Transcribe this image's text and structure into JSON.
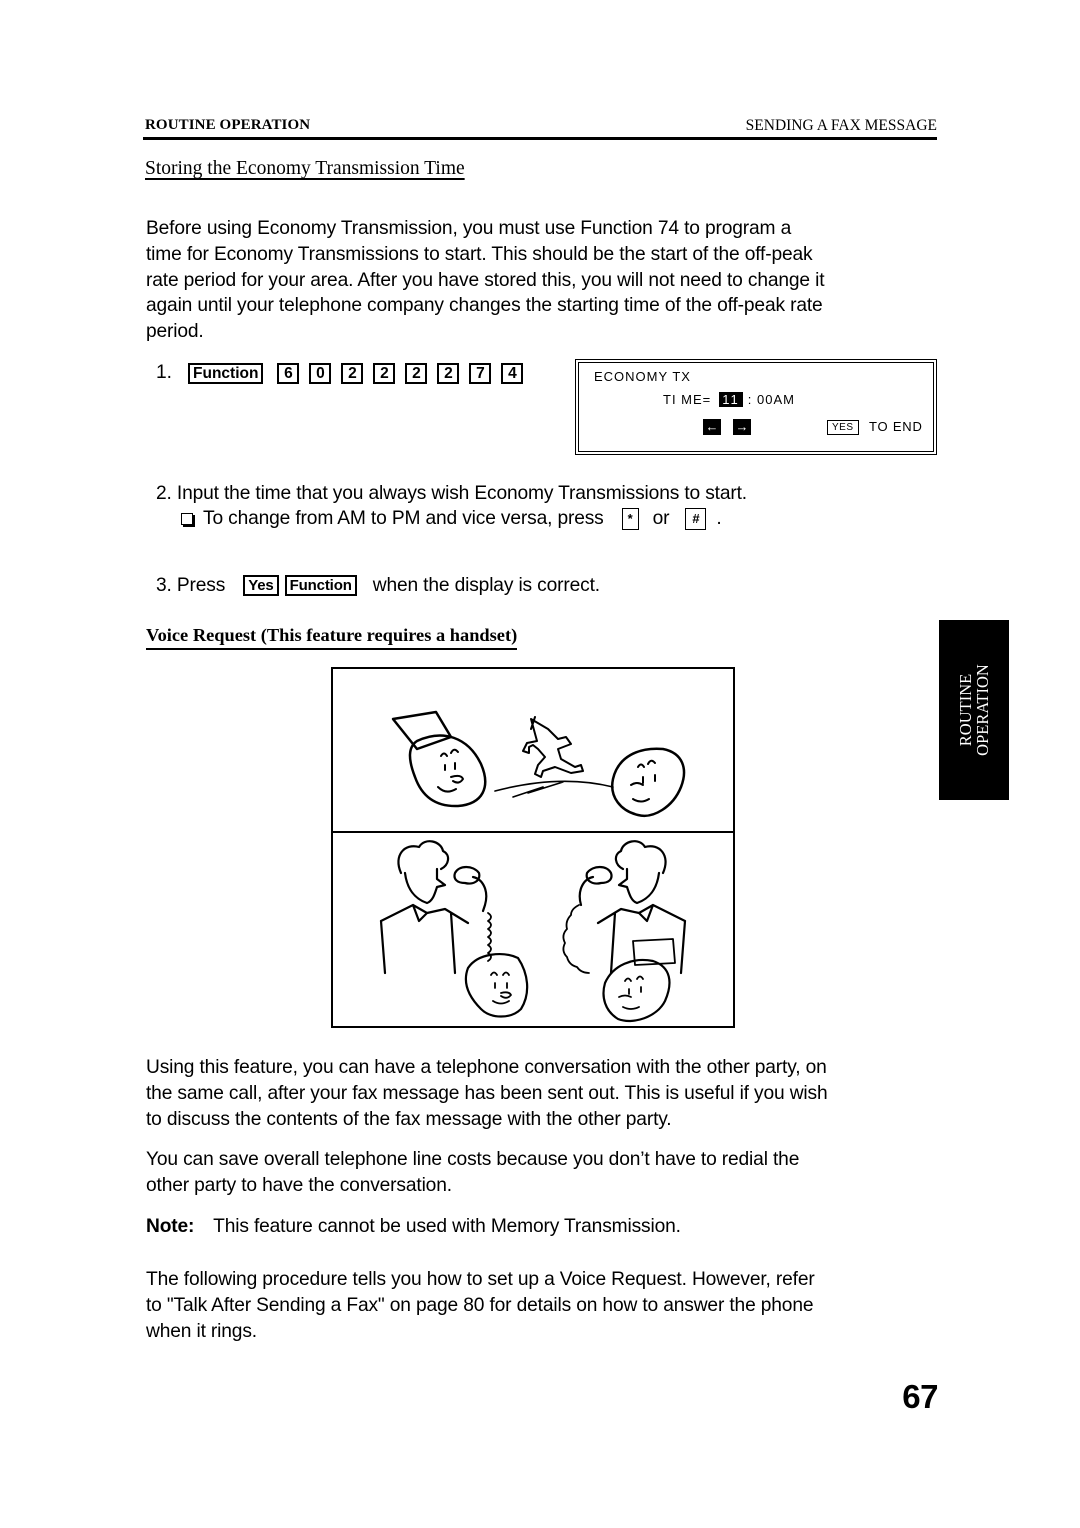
{
  "header": {
    "section": "ROUTINE OPERATION",
    "chapter": "SENDING A FAX MESSAGE"
  },
  "section_title": "Storing the Economy Transmission Time",
  "intro_lines": [
    "Before using Economy Transmission, you must use Function 74 to program a",
    "time for Economy Transmissions to start. This should be the start of the off-peak",
    "rate period for your area. After you have stored this, you will not need to change it",
    "again until your telephone company changes the starting time of the off-peak rate",
    "period."
  ],
  "step1": {
    "number": "1.",
    "function_key": "Function",
    "digit_keys": [
      "6",
      "0",
      "2",
      "2",
      "2",
      "2",
      "7",
      "4"
    ]
  },
  "lcd_display": {
    "line1": "ECONOMY TX",
    "time_label": "TI ME=",
    "time_hour": "11",
    "time_rest": ": 00AM",
    "left_arrow": "←",
    "right_arrow": "→",
    "yes_key": "YES",
    "end_text": "TO END"
  },
  "step2": {
    "text": "2. Input the time that you always wish Economy Transmissions to start.",
    "sub_text": "To change from AM to PM and vice versa, press",
    "key_star": "*",
    "or_text": "or",
    "key_hash": "#",
    "end_punct": "."
  },
  "step3": {
    "prefix": "3. Press",
    "keys": [
      "Yes",
      "Function"
    ],
    "suffix": "when the display is correct."
  },
  "section2_title": "Voice Request (This feature requires a handset)",
  "illustration": {
    "top_panel": "fax-machines-sending-message",
    "bottom_panel": "two-people-talking-on-handsets"
  },
  "side_tab": {
    "line1": "ROUTINE",
    "line2": "OPERATION"
  },
  "para_usage_lines": [
    "Using this feature, you can have a telephone conversation with the other party, on",
    "the same call, after your fax message has been sent out. This is useful if you wish",
    "to discuss the contents of the fax message with the other party."
  ],
  "para_savings_lines": [
    "You can save overall telephone line costs because you don’t have to redial the",
    "other party to have the conversation."
  ],
  "note": {
    "label": "Note:",
    "text": "This feature cannot be used with Memory Transmission."
  },
  "para_procedure_lines": [
    "The following procedure tells you how to set up a Voice Request. However, refer",
    "to \"Talk After Sending a Fax\" on page 80 for details on how to answer the phone",
    "when it rings."
  ],
  "page_number": "67"
}
